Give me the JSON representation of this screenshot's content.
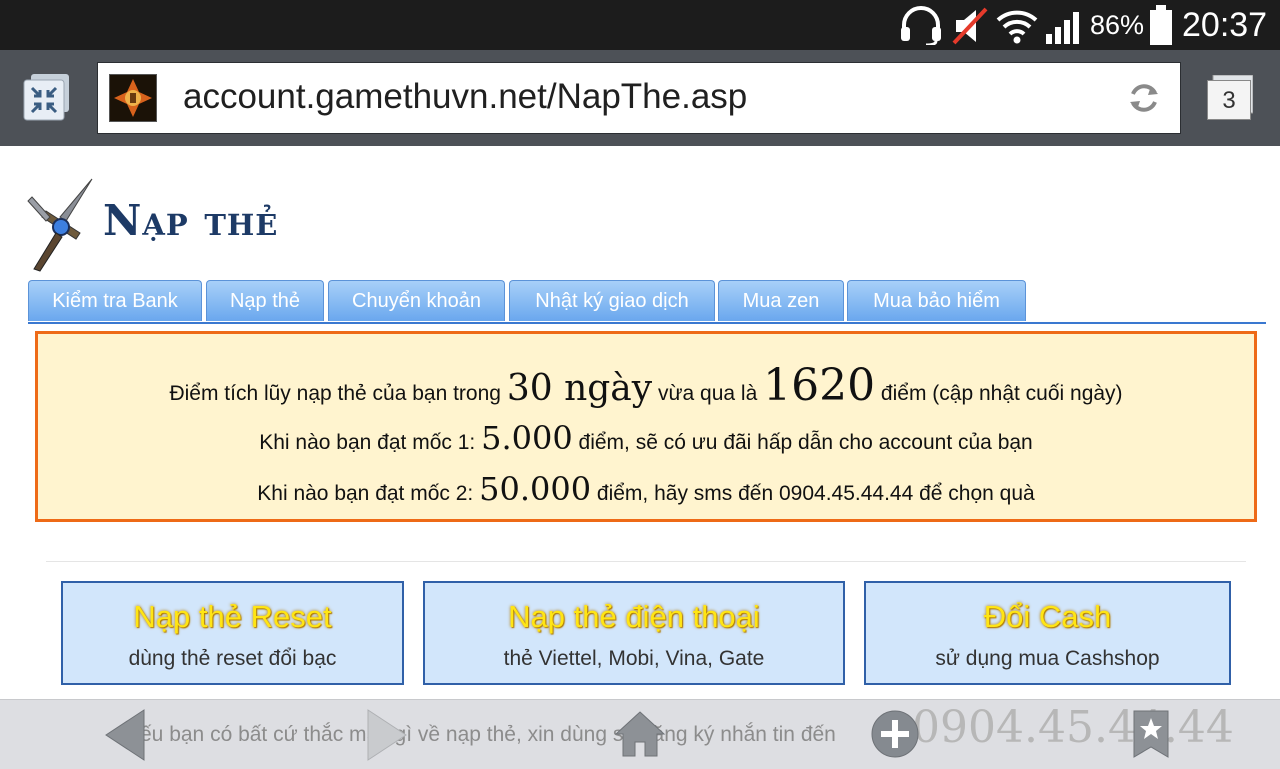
{
  "status_bar": {
    "battery_percent": "86%",
    "time": "20:37",
    "icons": [
      "headset-icon",
      "mute-icon",
      "wifi-icon",
      "signal-icon",
      "battery-icon"
    ]
  },
  "browser": {
    "url": "account.gamethuvn.net/NapThe.asp",
    "tab_count": "3",
    "icons": [
      "collapse-icon",
      "favicon",
      "reload-icon",
      "tabs-icon"
    ]
  },
  "page": {
    "title": "Nạp thẻ",
    "tabs": [
      {
        "label": "Kiểm tra Bank"
      },
      {
        "label": "Nạp thẻ"
      },
      {
        "label": "Chuyển khoản"
      },
      {
        "label": "Nhật ký giao dịch"
      },
      {
        "label": "Mua zen"
      },
      {
        "label": "Mua bảo hiểm"
      }
    ],
    "notice": {
      "line1_a": "Điểm tích lũy nạp thẻ của bạn trong",
      "line1_days": "30 ngày",
      "line1_b": "vừa qua là",
      "line1_points": "1620",
      "line1_c": "điểm (cập nhật cuối ngày)",
      "line2_a": "Khi nào bạn đạt mốc 1:",
      "line2_value": "5.000",
      "line2_b": "điểm, sẽ có ưu đãi hấp dẫn cho account của bạn",
      "line3_a": "Khi nào bạn đạt mốc 2:",
      "line3_value": "50.000",
      "line3_b": "điểm, hãy sms đến 0904.45.44.44 để chọn quà"
    },
    "cards": [
      {
        "title": "Nạp thẻ Reset",
        "subtitle": "dùng thẻ reset đổi bạc"
      },
      {
        "title": "Nạp thẻ điện thoại",
        "subtitle": "thẻ Viettel, Mobi, Vina, Gate"
      },
      {
        "title": "Đổi Cash",
        "subtitle": "sử dụng mua Cashshop"
      }
    ],
    "footer_note": "ếu bạn có bất cứ thắc mắc gì về nạp thẻ, xin dùng số đăng ký nhắn tin đến",
    "footer_phone": "0904.45.44.44"
  },
  "bottom_nav": {
    "icons": [
      "back-icon",
      "forward-icon",
      "home-icon",
      "new-tab-icon",
      "bookmark-icon"
    ]
  },
  "colors": {
    "notice_bg": "#fff4cf",
    "notice_border": "#ee6a17",
    "tab_blue": "#6aa7ee",
    "card_bg": "#d2e6fb",
    "card_title": "#ffe514",
    "title_navy": "#1d3a66"
  }
}
